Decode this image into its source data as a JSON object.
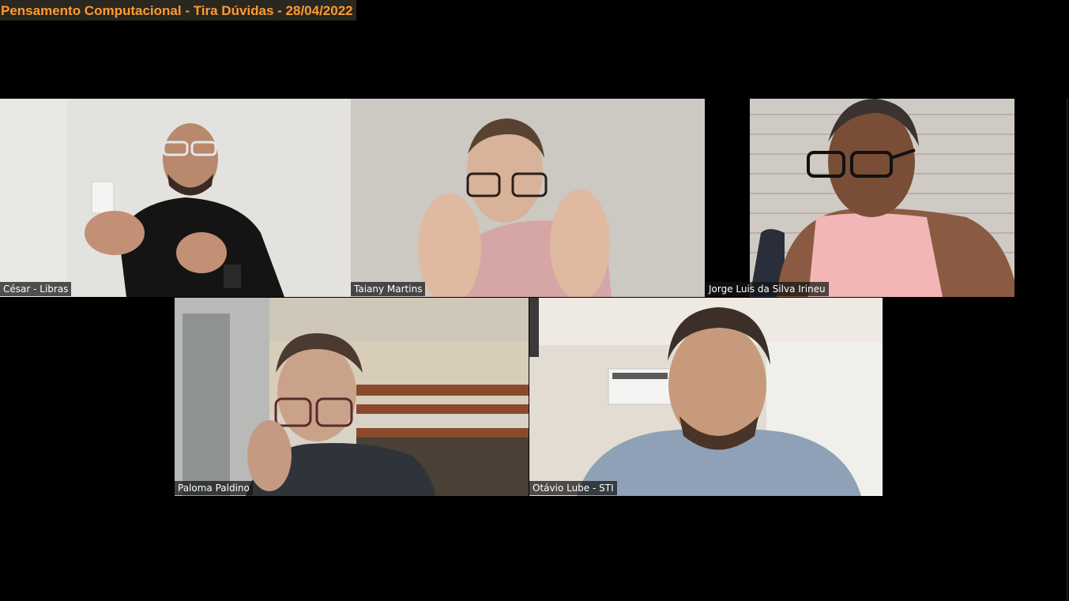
{
  "meeting": {
    "title": "Pensamento Computacional - Tira Dúvidas - 28/04/2022"
  },
  "participants": [
    {
      "name": "César - Libras"
    },
    {
      "name": "Taiany Martins"
    },
    {
      "name": "Jorge Luis da Silva Irineu"
    },
    {
      "name": "Paloma Paldino"
    },
    {
      "name": "Otávio Lube - STI"
    }
  ],
  "colors": {
    "title_text": "#ff9b2f",
    "title_background": "#2a2620",
    "background": "#000000"
  }
}
